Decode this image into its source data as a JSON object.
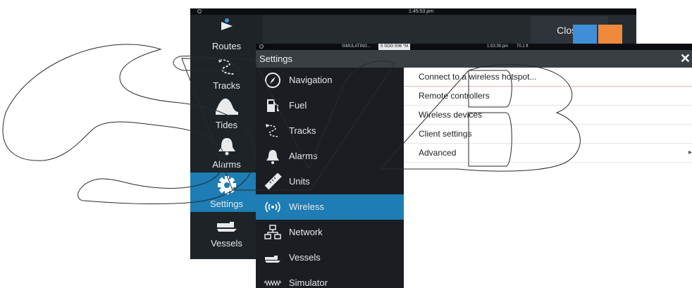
{
  "back_window": {
    "clock": "1:45:53 pm",
    "close_label": "Close",
    "rail": [
      {
        "label": "Routes",
        "icon": "routes-icon"
      },
      {
        "label": "Tracks",
        "icon": "tracks-icon"
      },
      {
        "label": "Tides",
        "icon": "tides-icon"
      },
      {
        "label": "Alarms",
        "icon": "alarms-icon"
      },
      {
        "label": "Settings",
        "icon": "settings-icon",
        "active": true
      },
      {
        "label": "Vessels",
        "icon": "vessels-icon"
      }
    ]
  },
  "front_window": {
    "status": {
      "simulating": "SIMULATING...",
      "sog": "5 SOG 006 °M",
      "clock": "1:53:39 pm",
      "depth": "70.1 ft"
    },
    "title": "Settings",
    "close_icon": "close-icon",
    "menu": [
      {
        "label": "Navigation",
        "icon": "compass-icon"
      },
      {
        "label": "Fuel",
        "icon": "fuel-pump-icon"
      },
      {
        "label": "Tracks",
        "icon": "tracks-icon"
      },
      {
        "label": "Alarms",
        "icon": "bell-icon"
      },
      {
        "label": "Units",
        "icon": "ruler-icon"
      },
      {
        "label": "Wireless",
        "icon": "wireless-icon",
        "active": true
      },
      {
        "label": "Network",
        "icon": "network-icon"
      },
      {
        "label": "Vessels",
        "icon": "vessels-icon"
      },
      {
        "label": "Simulator",
        "icon": "simulator-icon"
      }
    ],
    "options": [
      {
        "label": "Connect to a wireless hotspot..."
      },
      {
        "label": "Remote controllers"
      },
      {
        "label": "Wireless devices"
      },
      {
        "label": "Client settings"
      },
      {
        "label": "Advanced"
      }
    ]
  },
  "colors": {
    "accent": "#1d7db4",
    "panel_dark": "#1a1e22",
    "title_bar": "#3a3f44"
  }
}
